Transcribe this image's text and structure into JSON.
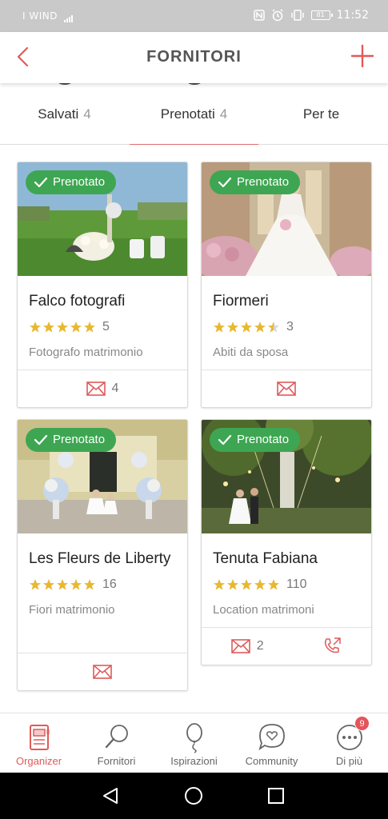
{
  "status_bar": {
    "carrier": "I WIND",
    "time": "11:52",
    "battery": "81"
  },
  "header": {
    "title": "FORNITORI"
  },
  "tabs": [
    {
      "label": "Salvati",
      "count": "4"
    },
    {
      "label": "Prenotati",
      "count": "4"
    },
    {
      "label": "Per te",
      "count": ""
    }
  ],
  "booked_badge": "Prenotato",
  "vendors": [
    {
      "name": "Falco fotografi",
      "rating": 5,
      "reviews": "5",
      "category": "Fotografo matrimonio",
      "messages": "4"
    },
    {
      "name": "Fiormeri",
      "rating": 4.5,
      "reviews": "3",
      "category": "Abiti da sposa",
      "messages": ""
    },
    {
      "name": "Les Fleurs de Liberty",
      "rating": 5,
      "reviews": "16",
      "category": "Fiori matrimonio",
      "messages": ""
    },
    {
      "name": "Tenuta Fabiana",
      "rating": 5,
      "reviews": "110",
      "category": "Location matrimoni",
      "messages": "2"
    }
  ],
  "bottom_nav": [
    {
      "label": "Organizer",
      "icon": "organizer-icon"
    },
    {
      "label": "Fornitori",
      "icon": "search-icon"
    },
    {
      "label": "Ispirazioni",
      "icon": "balloon-icon"
    },
    {
      "label": "Community",
      "icon": "chat-heart-icon"
    },
    {
      "label": "Di più",
      "icon": "more-icon",
      "badge": "9"
    }
  ],
  "colors": {
    "accent": "#e05a5a",
    "badge_green": "#3ea652",
    "star": "#e8b830"
  }
}
